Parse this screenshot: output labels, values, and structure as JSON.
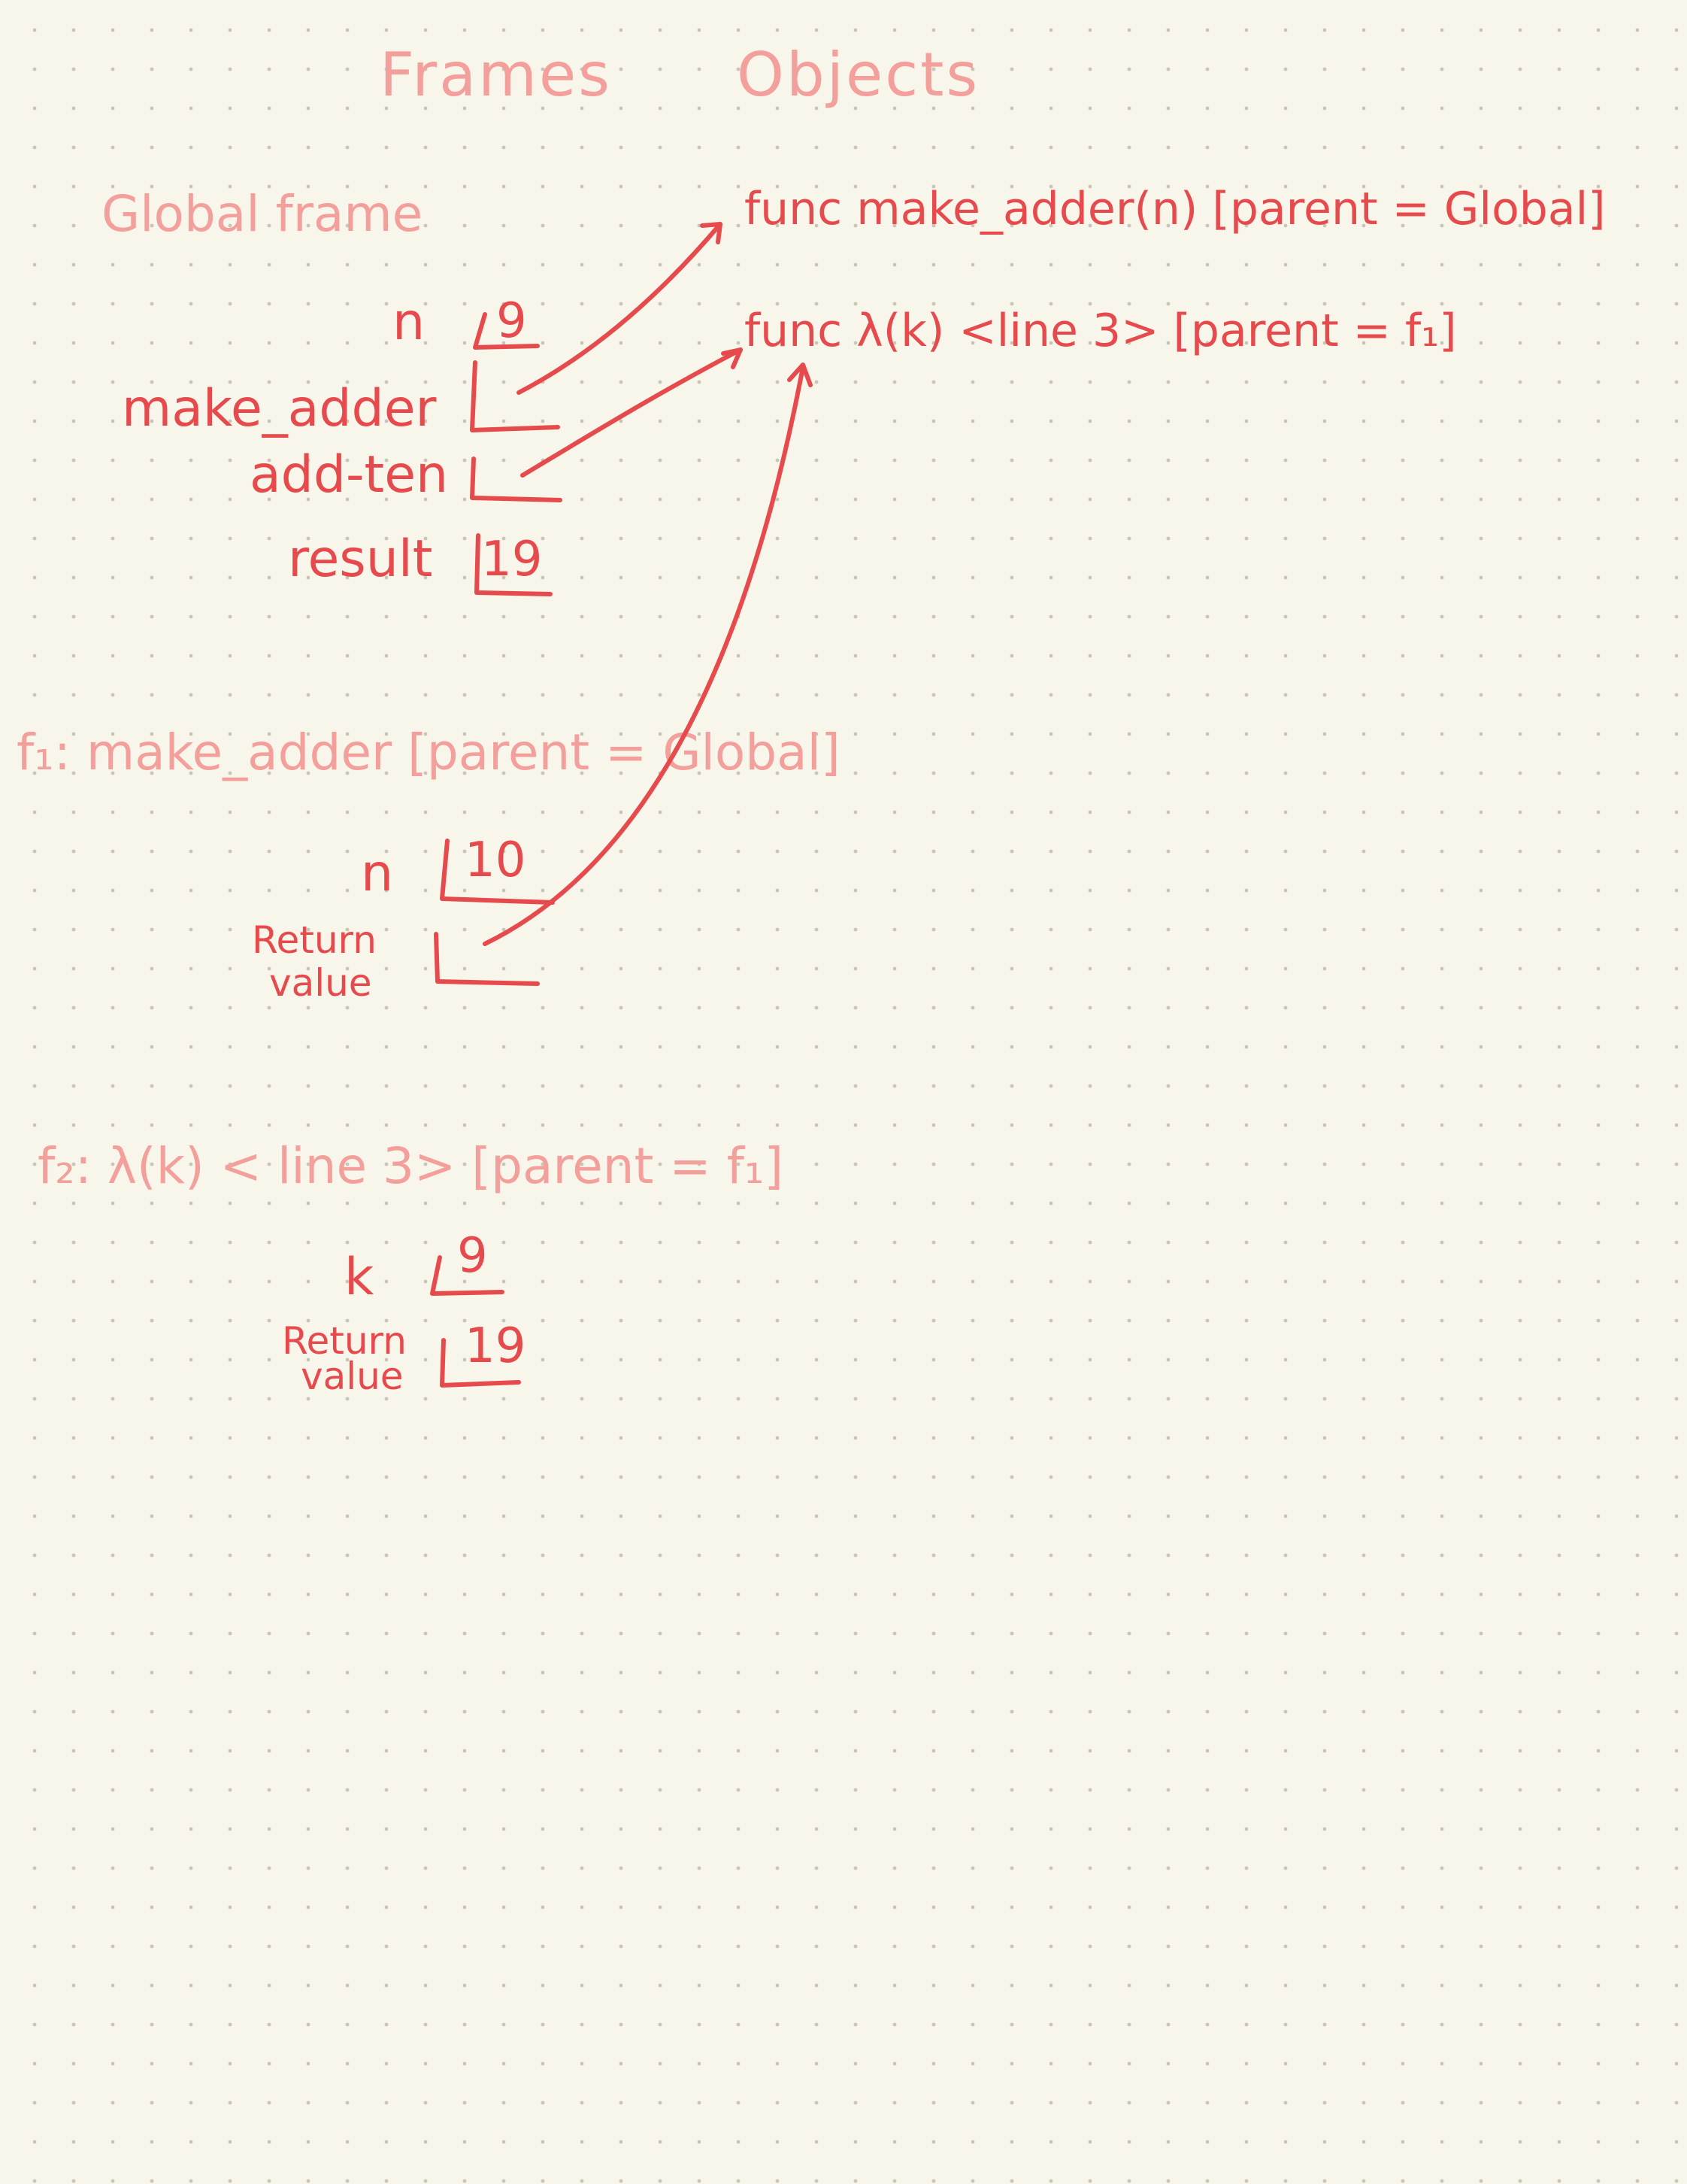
{
  "headings": {
    "frames": "Frames",
    "objects": "Objects"
  },
  "global_frame": {
    "title": "Global frame",
    "bindings": [
      {
        "name": "n",
        "value": "9"
      },
      {
        "name": "make_adder",
        "value": ""
      },
      {
        "name": "add-ten",
        "value": ""
      },
      {
        "name": "result",
        "value": "19"
      }
    ]
  },
  "objects": [
    {
      "text": "func  make_adder(n)  [parent = Global]"
    },
    {
      "text": "func  λ(k)  <line 3>  [parent = f₁]"
    }
  ],
  "frame_f1": {
    "title": "f₁:  make_adder [parent = Global]",
    "bindings": [
      {
        "name": "n",
        "value": "10"
      },
      {
        "name_line1": "Return",
        "name_line2": "value",
        "value": ""
      }
    ]
  },
  "frame_f2": {
    "title": "f₂:  λ(k)   < line 3> [parent = f₁]",
    "bindings": [
      {
        "name": "k",
        "value": "9"
      },
      {
        "name_line1": "Return",
        "name_line2": "value",
        "value": "19"
      }
    ]
  },
  "colors": {
    "background": "#f8f5ea",
    "pink_ink": "#f39f9c",
    "red_ink": "#e64a4d",
    "dot_grid": "#c9c5b8"
  }
}
